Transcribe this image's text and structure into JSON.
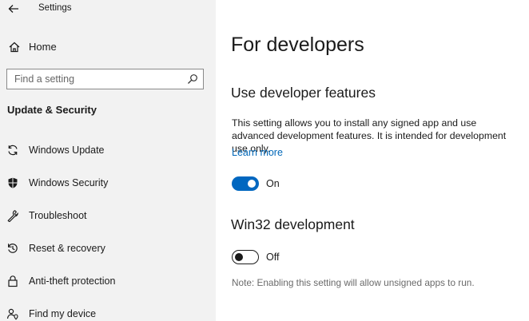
{
  "app": {
    "title": "Settings"
  },
  "sidebar": {
    "home_label": "Home",
    "search_placeholder": "Find a setting",
    "section_title": "Update & Security",
    "items": [
      {
        "label": "Windows Update",
        "icon": "sync-icon"
      },
      {
        "label": "Windows Security",
        "icon": "shield-icon"
      },
      {
        "label": "Troubleshoot",
        "icon": "wrench-icon"
      },
      {
        "label": "Reset & recovery",
        "icon": "reset-icon"
      },
      {
        "label": "Anti-theft protection",
        "icon": "lock-icon"
      },
      {
        "label": "Find my device",
        "icon": "location-person-icon"
      }
    ]
  },
  "main": {
    "title": "For developers",
    "developer_features": {
      "heading": "Use developer features",
      "description": "This setting allows you to install any signed app and use advanced development features. It is intended for development use only.",
      "learn_more": "Learn more",
      "toggle_state": "On",
      "toggle_on": true
    },
    "win32": {
      "heading": "Win32 development",
      "toggle_state": "Off",
      "toggle_on": false,
      "note": "Note: Enabling this setting will allow unsigned apps to run."
    }
  },
  "colors": {
    "accent": "#0067c0",
    "link": "#0067b8",
    "sidebar_bg": "#f2f2f2"
  }
}
